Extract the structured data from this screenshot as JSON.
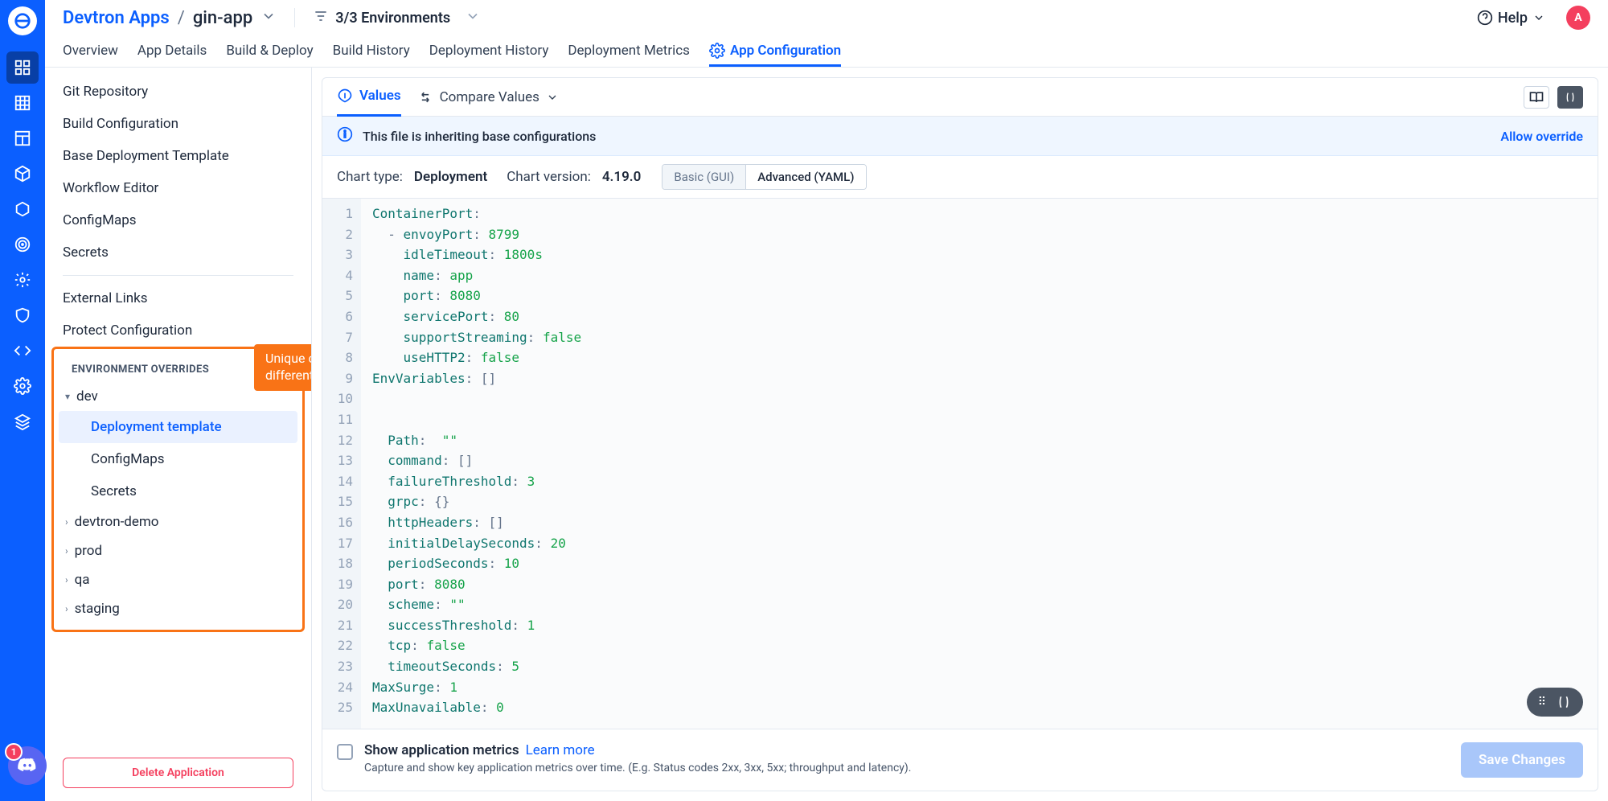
{
  "breadcrumb": {
    "root": "Devtron Apps",
    "leaf": "gin-app"
  },
  "env_filter_label": "3/3 Environments",
  "help_label": "Help",
  "avatar_initial": "A",
  "discord_badge": "1",
  "tabs": {
    "overview": "Overview",
    "app_details": "App Details",
    "build_deploy": "Build & Deploy",
    "build_history": "Build History",
    "deployment_history": "Deployment History",
    "deployment_metrics": "Deployment Metrics",
    "app_config": "App Configuration"
  },
  "config_sidebar": {
    "git_repo": "Git Repository",
    "build_config": "Build Configuration",
    "base_template": "Base Deployment Template",
    "workflow_editor": "Workflow Editor",
    "configmaps": "ConfigMaps",
    "secrets": "Secrets",
    "external_links": "External Links",
    "protect_config": "Protect Configuration",
    "env_overrides_header": "ENVIRONMENT OVERRIDES",
    "env_callout": "Unique configurations for different enviornments",
    "envs": {
      "dev": "dev",
      "devtron_demo": "devtron-demo",
      "prod": "prod",
      "qa": "qa",
      "staging": "staging"
    },
    "dev_children": {
      "deployment_template": "Deployment template",
      "configmaps": "ConfigMaps",
      "secrets": "Secrets"
    },
    "delete_app": "Delete Application"
  },
  "panel": {
    "values_tab": "Values",
    "compare_tab": "Compare Values",
    "info_msg": "This file is inheriting base configurations",
    "allow_override": "Allow override",
    "chart_type_lbl": "Chart type:",
    "chart_type_val": "Deployment",
    "chart_ver_lbl": "Chart version:",
    "chart_ver_val": "4.19.0",
    "seg_basic": "Basic (GUI)",
    "seg_advanced": "Advanced (YAML)",
    "footer_title": "Show application metrics",
    "footer_learn": "Learn more",
    "footer_sub": "Capture and show key application metrics over time. (E.g. Status codes 2xx, 3xx, 5xx; throughput and latency).",
    "save_btn": "Save Changes"
  },
  "code": [
    {
      "n": 1,
      "html": "<span class='k'>ContainerPort</span><span class='punct'>:</span>"
    },
    {
      "n": 2,
      "html": "  <span class='punct'>-</span> <span class='k'>envoyPort</span><span class='punct'>:</span> <span class='num'>8799</span>"
    },
    {
      "n": 3,
      "html": "    <span class='k'>idleTimeout</span><span class='punct'>:</span> <span class='num'>1800s</span>"
    },
    {
      "n": 4,
      "html": "    <span class='k'>name</span><span class='punct'>:</span> <span class='num'>app</span>"
    },
    {
      "n": 5,
      "html": "    <span class='k'>port</span><span class='punct'>:</span> <span class='num'>8080</span>"
    },
    {
      "n": 6,
      "html": "    <span class='k'>servicePort</span><span class='punct'>:</span> <span class='num'>80</span>"
    },
    {
      "n": 7,
      "html": "    <span class='k'>supportStreaming</span><span class='punct'>:</span> <span class='bool'>false</span>"
    },
    {
      "n": 8,
      "html": "    <span class='k'>useHTTP2</span><span class='punct'>:</span> <span class='bool'>false</span>"
    },
    {
      "n": 9,
      "html": "<span class='k'>EnvVariables</span><span class='punct'>:</span> <span class='punct'>[]</span>"
    },
    {
      "n": 10,
      "html": ""
    },
    {
      "n": 11,
      "html": ""
    },
    {
      "n": 12,
      "html": "  <span class='k'>Path</span><span class='punct'>:</span>  <span class='str'>\"\"</span>"
    },
    {
      "n": 13,
      "html": "  <span class='k'>command</span><span class='punct'>:</span> <span class='punct'>[]</span>"
    },
    {
      "n": 14,
      "html": "  <span class='k'>failureThreshold</span><span class='punct'>:</span> <span class='num'>3</span>"
    },
    {
      "n": 15,
      "html": "  <span class='k'>grpc</span><span class='punct'>:</span> <span class='punct'>{}</span>"
    },
    {
      "n": 16,
      "html": "  <span class='k'>httpHeaders</span><span class='punct'>:</span> <span class='punct'>[]</span>"
    },
    {
      "n": 17,
      "html": "  <span class='k'>initialDelaySeconds</span><span class='punct'>:</span> <span class='num'>20</span>"
    },
    {
      "n": 18,
      "html": "  <span class='k'>periodSeconds</span><span class='punct'>:</span> <span class='num'>10</span>"
    },
    {
      "n": 19,
      "html": "  <span class='k'>port</span><span class='punct'>:</span> <span class='num'>8080</span>"
    },
    {
      "n": 20,
      "html": "  <span class='k'>scheme</span><span class='punct'>:</span> <span class='str'>\"\"</span>"
    },
    {
      "n": 21,
      "html": "  <span class='k'>successThreshold</span><span class='punct'>:</span> <span class='num'>1</span>"
    },
    {
      "n": 22,
      "html": "  <span class='k'>tcp</span><span class='punct'>:</span> <span class='bool'>false</span>"
    },
    {
      "n": 23,
      "html": "  <span class='k'>timeoutSeconds</span><span class='punct'>:</span> <span class='num'>5</span>"
    },
    {
      "n": 24,
      "html": "<span class='k'>MaxSurge</span><span class='punct'>:</span> <span class='num'>1</span>"
    },
    {
      "n": 25,
      "html": "<span class='k'>MaxUnavailable</span><span class='punct'>:</span> <span class='num'>0</span>"
    }
  ]
}
